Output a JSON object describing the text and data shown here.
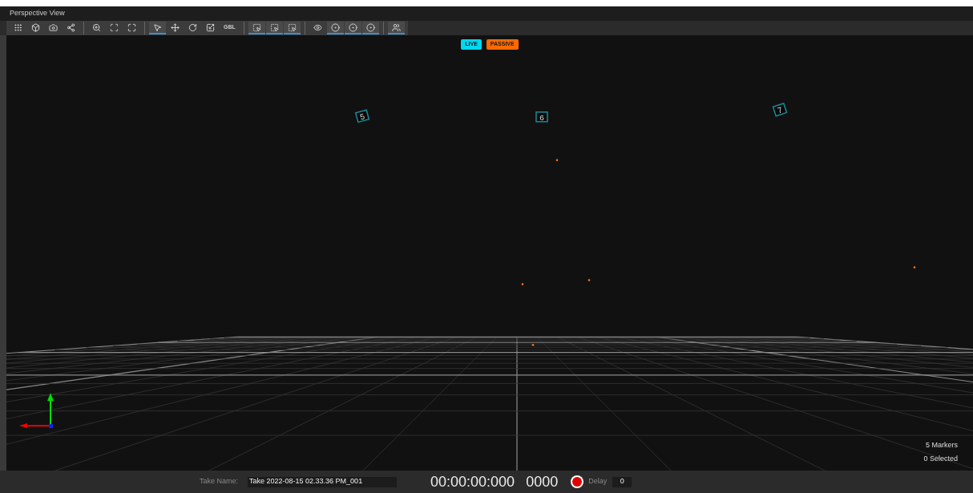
{
  "window": {
    "title": "Perspective View"
  },
  "toolbar": [
    {
      "kind": "grid",
      "selected": false
    },
    {
      "kind": "cube",
      "selected": false
    },
    {
      "kind": "camera",
      "selected": false
    },
    {
      "kind": "nodes",
      "selected": false
    },
    {
      "kind": "sep"
    },
    {
      "kind": "zoom",
      "selected": false
    },
    {
      "kind": "zoom-box",
      "selected": false
    },
    {
      "kind": "fit",
      "selected": false
    },
    {
      "kind": "sep"
    },
    {
      "kind": "select",
      "selected": true
    },
    {
      "kind": "move",
      "selected": false
    },
    {
      "kind": "rotate",
      "selected": false
    },
    {
      "kind": "scale",
      "selected": false
    },
    {
      "kind": "text",
      "label": "GBL",
      "selected": false
    },
    {
      "kind": "sep"
    },
    {
      "kind": "box-select",
      "selected": true
    },
    {
      "kind": "box-select",
      "selected": true
    },
    {
      "kind": "box-select",
      "selected": true
    },
    {
      "kind": "sep"
    },
    {
      "kind": "eye",
      "selected": false
    },
    {
      "kind": "marker",
      "selected": true
    },
    {
      "kind": "marker",
      "selected": true
    },
    {
      "kind": "marker",
      "selected": true
    },
    {
      "kind": "sep"
    },
    {
      "kind": "skeleton",
      "selected": true
    }
  ],
  "badges": [
    {
      "label": "LIVE",
      "color": "#00d8f0"
    },
    {
      "label": "PASSIVE",
      "color": "#ff6a00"
    }
  ],
  "cameras": [
    {
      "label": "5"
    },
    {
      "label": "6"
    },
    {
      "label": "7"
    }
  ],
  "status": {
    "markers": "5 Markers",
    "selected": "0 Selected"
  },
  "bottom_bar": {
    "take_label": "Take Name:",
    "take_value": "Take 2022-08-15 02.33.36 PM_001",
    "timecode": "00:00:00:000",
    "frame": "0000",
    "recording": false,
    "delay_label": "Delay",
    "delay_value": "0"
  }
}
